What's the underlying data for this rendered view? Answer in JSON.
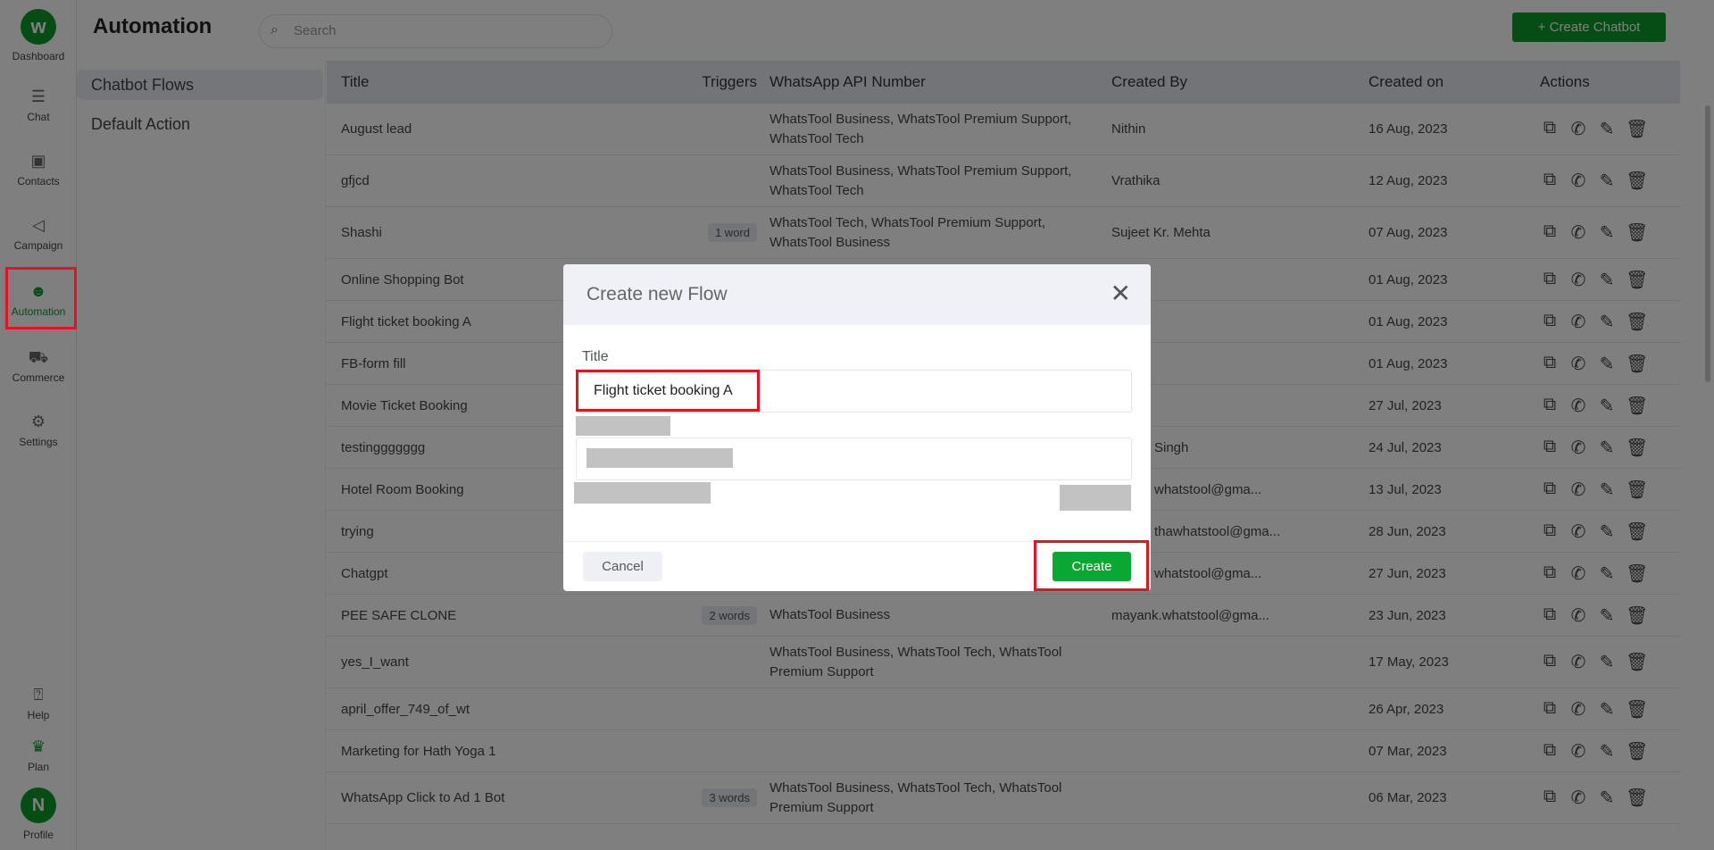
{
  "rail": {
    "items": [
      {
        "label": "Dashboard",
        "icon": "logo-icon"
      },
      {
        "label": "Chat",
        "icon": "chat-icon"
      },
      {
        "label": "Contacts",
        "icon": "contacts-icon"
      },
      {
        "label": "Campaign",
        "icon": "megaphone-icon"
      },
      {
        "label": "Automation",
        "icon": "bot-icon"
      },
      {
        "label": "Commerce",
        "icon": "cart-icon"
      },
      {
        "label": "Settings",
        "icon": "gear-icon"
      },
      {
        "label": "Help",
        "icon": "help-icon"
      },
      {
        "label": "Plan",
        "icon": "crown-icon"
      },
      {
        "label": "Profile",
        "icon": "avatar",
        "initial": "N"
      }
    ]
  },
  "header": {
    "title": "Automation",
    "search_placeholder": "Search",
    "create_label": "+ Create Chatbot"
  },
  "sidebar": {
    "items": [
      {
        "label": "Chatbot Flows",
        "active": true
      },
      {
        "label": "Default Action"
      }
    ]
  },
  "table": {
    "columns": [
      "Title",
      "Triggers",
      "WhatsApp API Number",
      "Created By",
      "Created on",
      "Actions"
    ],
    "rows": [
      {
        "title": "August lead",
        "trigger": "",
        "api": "WhatsTool Business, WhatsTool Premium Support, WhatsTool Tech",
        "by": "Nithin",
        "on": "16 Aug, 2023"
      },
      {
        "title": "gfjcd",
        "trigger": "",
        "api": "WhatsTool Business, WhatsTool Premium Support, WhatsTool Tech",
        "by": "Vrathika",
        "on": "12 Aug, 2023"
      },
      {
        "title": "Shashi",
        "trigger": "1 word",
        "api": "WhatsTool Tech, WhatsTool Premium Support, WhatsTool Business",
        "by": "Sujeet Kr. Mehta",
        "on": "07 Aug, 2023"
      },
      {
        "title": "Online Shopping Bot",
        "trigger": "",
        "api": "",
        "by": "",
        "on": "01 Aug, 2023"
      },
      {
        "title": "Flight ticket booking A",
        "trigger": "",
        "api": "",
        "by": "",
        "on": "01 Aug, 2023"
      },
      {
        "title": "FB-form fill",
        "trigger": "",
        "api": "",
        "by": "",
        "on": "01 Aug, 2023"
      },
      {
        "title": "Movie Ticket Booking",
        "trigger": "",
        "api": "",
        "by": "",
        "on": "27 Jul, 2023"
      },
      {
        "title": "testinggggggg",
        "trigger": "",
        "api": "",
        "by": "Singh",
        "on": "24 Jul, 2023",
        "clipped": true
      },
      {
        "title": "Hotel Room Booking",
        "trigger": "",
        "api": "",
        "by": "whatstool@gma...",
        "on": "13 Jul, 2023",
        "clipped": true
      },
      {
        "title": "trying",
        "trigger": "",
        "api": "",
        "by": "thawhatstool@gma...",
        "on": "28 Jun, 2023",
        "clipped": true
      },
      {
        "title": "Chatgpt",
        "trigger": "",
        "api": "",
        "by": "whatstool@gma...",
        "on": "27 Jun, 2023",
        "clipped": true
      },
      {
        "title": "PEE SAFE CLONE",
        "trigger": "2 words",
        "api": "WhatsTool Business",
        "by": "mayank.whatstool@gma...",
        "on": "23 Jun, 2023"
      },
      {
        "title": "yes_I_want",
        "trigger": "",
        "api": "WhatsTool Business, WhatsTool Tech, WhatsTool Premium Support",
        "by": "",
        "on": "17 May, 2023"
      },
      {
        "title": "april_offer_749_of_wt",
        "trigger": "",
        "api": "",
        "by": "",
        "on": "26 Apr, 2023"
      },
      {
        "title": "Marketing for Hath Yoga 1",
        "trigger": "",
        "api": "",
        "by": "",
        "on": "07 Mar, 2023"
      },
      {
        "title": "WhatsApp Click to Ad 1 Bot",
        "trigger": "3 words",
        "api": "WhatsTool Business, WhatsTool Tech, WhatsTool Premium Support",
        "by": "",
        "on": "06 Mar, 2023"
      }
    ],
    "action_icons": [
      "open-external-icon",
      "whatsapp-icon",
      "pencil-icon",
      "trash-icon"
    ]
  },
  "modal": {
    "title": "Create new Flow",
    "title_label": "Title",
    "title_value": "Flight ticket booking A",
    "cancel_label": "Cancel",
    "create_label": "Create"
  },
  "colors": {
    "brand_green": "#0a9a2a",
    "create_green": "#0aa832",
    "highlight_red": "#e0161e"
  }
}
